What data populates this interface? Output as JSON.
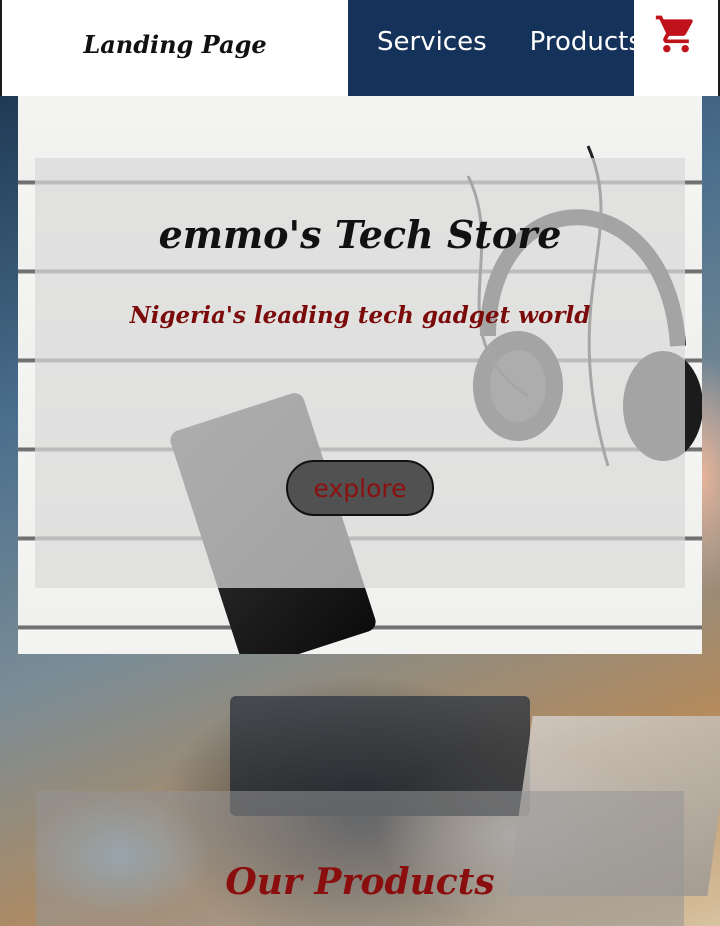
{
  "nav": {
    "logo": "Landing Page",
    "links": [
      {
        "label": "Services"
      },
      {
        "label": "Products"
      }
    ],
    "cart_icon": "shopping-cart-icon",
    "colors": {
      "nav_bg": "#15335a",
      "link": "#ffffff"
    }
  },
  "hero": {
    "title": "emmo's Tech Store",
    "subtitle": "Nigeria's leading tech gadget world",
    "button_label": "explore",
    "colors": {
      "subtitle": "#7b0a0a",
      "button_text": "#8b1010"
    }
  },
  "products": {
    "title": "Our Products",
    "colors": {
      "title": "#8a0e0e"
    }
  }
}
